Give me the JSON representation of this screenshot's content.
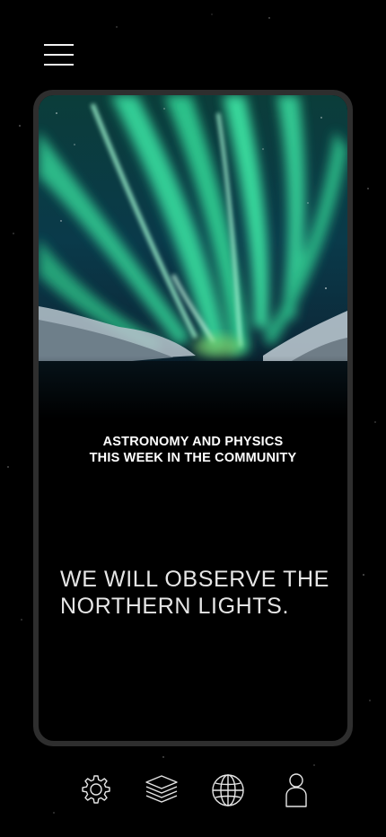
{
  "header": {
    "menu_icon": "hamburger-menu-icon"
  },
  "card": {
    "image": "northern-lights-photo",
    "eyebrow_line1": "ASTRONOMY AND PHYSICS",
    "eyebrow_line2": "THIS WEEK IN THE COMMUNITY",
    "headline_line1": "WE WILL OBSERVE THE",
    "headline_line2": "NORTHERN LIGHTS."
  },
  "bottom_nav": {
    "items": [
      {
        "icon": "gear-icon"
      },
      {
        "icon": "layers-icon"
      },
      {
        "icon": "globe-icon"
      },
      {
        "icon": "user-icon"
      }
    ]
  },
  "colors": {
    "background": "#000000",
    "card_border": "#2e2e2e",
    "aurora_green": "#3be0a0",
    "text": "#ffffff"
  }
}
